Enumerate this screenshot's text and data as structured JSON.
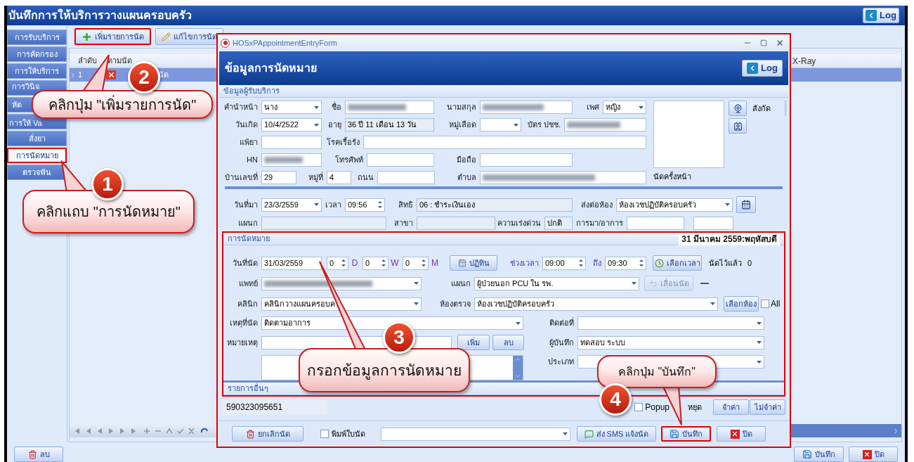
{
  "window": {
    "title": "บันทึกการให้บริการวางแผนครอบครัว",
    "log_button": "Log"
  },
  "sidebar": {
    "items": [
      {
        "label": "การรับบริการ",
        "selected": false,
        "highlighted": false
      },
      {
        "label": "การคัดกรอง",
        "selected": false,
        "highlighted": false
      },
      {
        "label": "การให้บริการ",
        "selected": false,
        "highlighted": false
      },
      {
        "label": "การวินิจ",
        "selected": false,
        "highlighted": false
      },
      {
        "label": "หัต",
        "selected": false,
        "highlighted": false
      },
      {
        "label": "การให้ Va",
        "selected": false,
        "highlighted": false
      },
      {
        "label": "สั่งยา",
        "selected": false,
        "highlighted": false
      },
      {
        "label": "การนัดหมาย",
        "selected": true,
        "highlighted": true
      },
      {
        "label": "ตรวจฟัน",
        "selected": false,
        "highlighted": false
      }
    ]
  },
  "toolbar": [
    {
      "label": "เพิ่มรายการนัด",
      "highlighted": true
    },
    {
      "label": "แก้ไขการนัด",
      "highlighted": false
    }
  ],
  "grid": {
    "columns": [
      "ลำดับ",
      "ตามนัด"
    ],
    "right_column": "X-Ray",
    "rows": [
      {
        "cells": [
          "1",
          "นัด"
        ],
        "selected": true
      }
    ]
  },
  "footer": {
    "left_button": "ลบ",
    "right_buttons": [
      "บันทึก",
      "ปิด"
    ]
  },
  "dialog": {
    "title": "HOSxPAppointmentEntryForm",
    "heading": "ข้อมูลการนัดหมาย",
    "log_button": "Log",
    "highlighted": true,
    "patient": {
      "title": "ข้อมูลผู้รับบริการ",
      "side_label": "สังกัด",
      "next_label": "นัดครั้งหน้า",
      "fields": [
        {
          "label": "คำนำหน้า",
          "kind": "combo",
          "value": "นาง"
        },
        {
          "label": "ชื่อ",
          "kind": "blurred"
        },
        {
          "label": "นามสกุล",
          "kind": "blurred"
        },
        {
          "label": "เพศ",
          "kind": "combo",
          "value": "หญิง"
        },
        {
          "label": "วันเกิด",
          "kind": "combo",
          "value": "10/4/2522"
        },
        {
          "label": "อายุ",
          "kind": "readonly",
          "value": "36 ปี 11 เดือน 13 วัน"
        },
        {
          "label": "หมู่เลือด",
          "kind": "combo"
        },
        {
          "label": "บัตร ปชช.",
          "kind": "blurred"
        },
        {
          "label": "แพ้ยา",
          "kind": "text"
        },
        {
          "label": "โรคเรื้อรัง",
          "kind": "text"
        },
        {
          "label": "HN",
          "kind": "blurred"
        },
        {
          "label": "โทรศัพท์",
          "kind": "text"
        },
        {
          "label": "มือถือ",
          "kind": "text"
        },
        {
          "label": "บ้านเลขที่",
          "kind": "text",
          "value": "29"
        },
        {
          "label": "หมู่ที่",
          "kind": "text",
          "value": "4"
        },
        {
          "label": "ถนน",
          "kind": "text"
        },
        {
          "label": "ตำบล",
          "kind": "blurred"
        }
      ]
    },
    "visit": {
      "fields": [
        {
          "label": "วันที่มา",
          "kind": "combo",
          "value": "23/3/2559"
        },
        {
          "label": "เวลา",
          "kind": "spin",
          "value": "09:56"
        },
        {
          "label": "สิทธิ",
          "kind": "readonly",
          "value": "06 : ชำระเงินเอง"
        },
        {
          "label": "ส่งต่อห้อง",
          "kind": "combo",
          "value": "ห้องเวชปฏิบัติครอบครัว"
        },
        {
          "label": "แผนก",
          "kind": "readonly"
        },
        {
          "label": "สาขา",
          "kind": "readonly"
        },
        {
          "label": "ความเร่งด่วน",
          "kind": "readonly",
          "value": "ปกติ"
        },
        {
          "label": "การมา/อาการ",
          "kind": "text"
        },
        {
          "kind": "text"
        }
      ]
    },
    "appointment": {
      "title": "การนัดหมาย",
      "date_text": "31 มีนาคม 2559:พฤหัสบดี",
      "highlighted": true,
      "fields": [
        {
          "label": "วันที่นัด",
          "kind": "text",
          "value": "31/03/2559"
        },
        {
          "kind": "spin",
          "value": "0",
          "unit": "D"
        },
        {
          "kind": "spin",
          "value": "0",
          "unit": "W"
        },
        {
          "kind": "spin",
          "value": "0",
          "unit": "M"
        },
        {
          "label": "ช่วงเวลา",
          "kind": "spin",
          "value": "09:00"
        },
        {
          "label": "ถึง",
          "kind": "spin",
          "value": "09:30"
        },
        {
          "label": "แพทย์",
          "kind": "blurredcombo"
        },
        {
          "label": "แผนก",
          "kind": "combo",
          "value": "ผู้ป่วยนอก PCU ใน รพ."
        },
        {
          "label": "คลินิก",
          "kind": "combo",
          "value": "คลินิกวางแผนครอบค"
        },
        {
          "label": "ห้องตรวจ",
          "kind": "combo",
          "value": "ห้องเวชปฏิบัติครอบครัว"
        },
        {
          "label": "เหตุที่นัด",
          "kind": "combo",
          "value": "ติดตามอาการ"
        },
        {
          "label": "ติดต่อที่",
          "kind": "combo"
        },
        {
          "label": "หมายเหตุ",
          "kind": "text"
        },
        {
          "label": "ผู้บันทึก",
          "kind": "combo",
          "value": "ทดสอบ ระบบ"
        },
        {
          "label": "ประเภท",
          "kind": "combo"
        },
        {
          "kind": "memo"
        }
      ],
      "buttons": [
        {
          "text": "ปฏิทิน",
          "disabled": false
        },
        {
          "text": "เลือกเวลา",
          "disabled": false
        },
        {
          "text": "เลื่อนนัด",
          "disabled": true
        },
        {
          "text": "เลือกห้อง",
          "disabled": false
        },
        {
          "text": "เพิ่ม",
          "disabled": false
        },
        {
          "text": "ลบ",
          "disabled": false
        }
      ],
      "booked_label": "นัดไว้แล้ว",
      "booked_count": "0",
      "all_checkbox": {
        "label": "All",
        "checked": false
      }
    },
    "other": {
      "title": "รายการอื่นๆ",
      "number": "590323095651",
      "popup": {
        "label_parts": [
          "Popup",
          "หยุด"
        ],
        "checked": false
      },
      "buttons": [
        "จำค่า",
        "ไม่จำค่า"
      ]
    },
    "bottom": {
      "cancel": "ยกเลิกนัด",
      "print": {
        "label": "พิมพ์ใบนัด",
        "checked": false
      },
      "sms": "ส่ง SMS แจ้งนัด",
      "save": {
        "text": "บันทึก",
        "highlighted": true
      },
      "close": "ปิด"
    }
  },
  "callouts": [
    {
      "number": "2",
      "text": "คลิกปุ่ม \"เพิ่มรายการนัด\""
    },
    {
      "number": "1",
      "text": "คลิกแถบ \"การนัดหมาย\""
    },
    {
      "number": "3",
      "text": "กรอกข้อมูลการนัดหมาย"
    },
    {
      "number": "4",
      "text": "คลิกปุ่ม \"บันทึก\""
    }
  ]
}
